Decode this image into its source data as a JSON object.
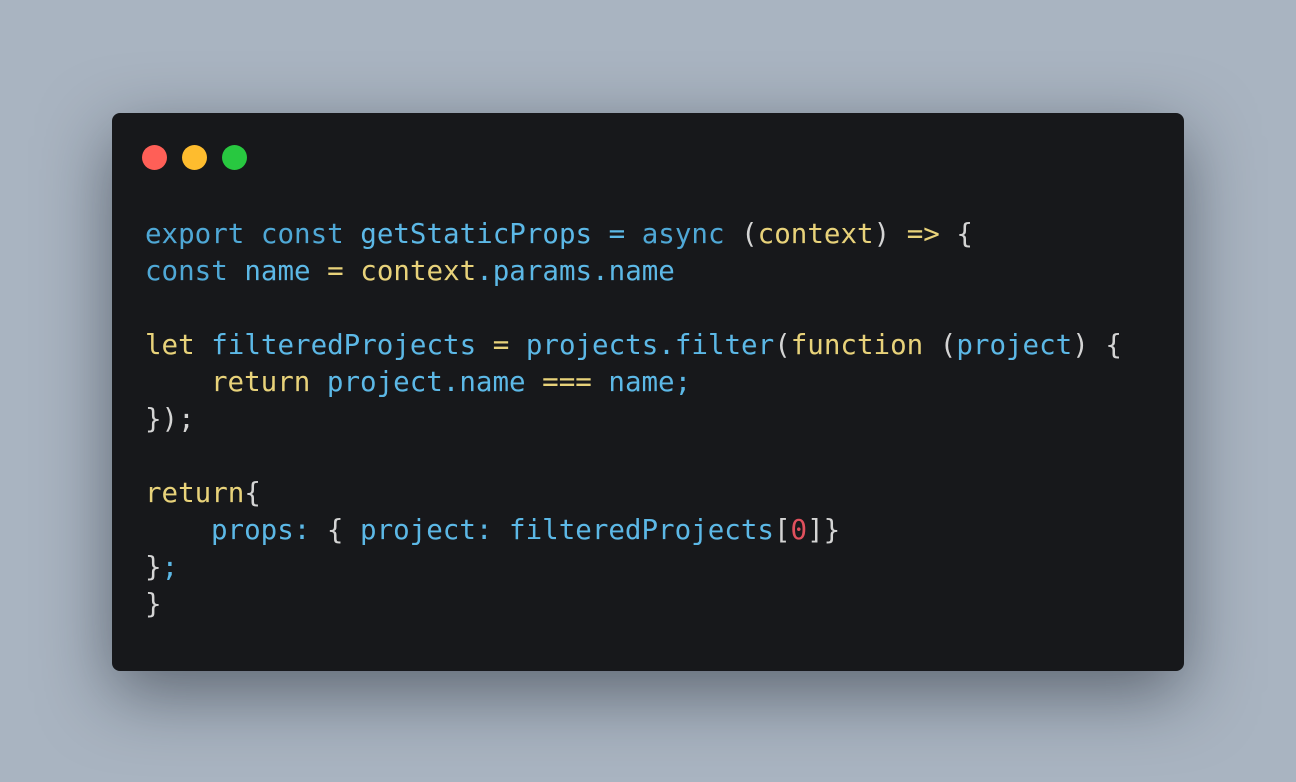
{
  "window": {
    "controls": [
      {
        "name": "close",
        "color": "#ff5f57"
      },
      {
        "name": "minimize",
        "color": "#febc2e"
      },
      {
        "name": "maximize",
        "color": "#28c840"
      }
    ]
  },
  "code": {
    "lines": [
      [
        {
          "text": "export",
          "cls": "kw"
        },
        {
          "text": " ",
          "cls": "pn"
        },
        {
          "text": "const",
          "cls": "kw"
        },
        {
          "text": " ",
          "cls": "pn"
        },
        {
          "text": "getStaticProps",
          "cls": "var"
        },
        {
          "text": " ",
          "cls": "pn"
        },
        {
          "text": "=",
          "cls": "var"
        },
        {
          "text": " ",
          "cls": "pn"
        },
        {
          "text": "async",
          "cls": "kw"
        },
        {
          "text": " ",
          "cls": "pn"
        },
        {
          "text": "(",
          "cls": "pn"
        },
        {
          "text": "context",
          "cls": "fn"
        },
        {
          "text": ")",
          "cls": "pn"
        },
        {
          "text": " ",
          "cls": "pn"
        },
        {
          "text": "=>",
          "cls": "op"
        },
        {
          "text": " {",
          "cls": "pn"
        }
      ],
      [
        {
          "text": "const",
          "cls": "kw"
        },
        {
          "text": " ",
          "cls": "pn"
        },
        {
          "text": "name",
          "cls": "var"
        },
        {
          "text": " ",
          "cls": "pn"
        },
        {
          "text": "=",
          "cls": "op"
        },
        {
          "text": " ",
          "cls": "pn"
        },
        {
          "text": "context",
          "cls": "fn"
        },
        {
          "text": ".params.name",
          "cls": "var"
        }
      ],
      [],
      [
        {
          "text": "let",
          "cls": "fn"
        },
        {
          "text": " ",
          "cls": "pn"
        },
        {
          "text": "filteredProjects",
          "cls": "var"
        },
        {
          "text": " ",
          "cls": "pn"
        },
        {
          "text": "=",
          "cls": "op"
        },
        {
          "text": " ",
          "cls": "pn"
        },
        {
          "text": "projects.filter",
          "cls": "var"
        },
        {
          "text": "(",
          "cls": "pn"
        },
        {
          "text": "function",
          "cls": "fn"
        },
        {
          "text": " (",
          "cls": "pn"
        },
        {
          "text": "project",
          "cls": "var"
        },
        {
          "text": ") {",
          "cls": "pn"
        }
      ],
      [
        {
          "text": "return",
          "cls": "fn"
        },
        {
          "text": " ",
          "cls": "pn"
        },
        {
          "text": "project.name",
          "cls": "var"
        },
        {
          "text": " ",
          "cls": "pn"
        },
        {
          "text": "===",
          "cls": "op"
        },
        {
          "text": " ",
          "cls": "pn"
        },
        {
          "text": "name;",
          "cls": "var"
        }
      ],
      [
        {
          "text": "});",
          "cls": "pn"
        }
      ],
      [],
      [
        {
          "text": "return",
          "cls": "fn"
        },
        {
          "text": "{",
          "cls": "pn"
        }
      ],
      [
        {
          "text": "props:",
          "cls": "var"
        },
        {
          "text": " { ",
          "cls": "pn"
        },
        {
          "text": "project:",
          "cls": "var"
        },
        {
          "text": " ",
          "cls": "pn"
        },
        {
          "text": "filteredProjects",
          "cls": "var"
        },
        {
          "text": "[",
          "cls": "pn"
        },
        {
          "text": "0",
          "cls": "num"
        },
        {
          "text": "]}",
          "cls": "pn"
        }
      ],
      [
        {
          "text": "}",
          "cls": "pn"
        },
        {
          "text": ";",
          "cls": "var"
        }
      ],
      [
        {
          "text": "}",
          "cls": "pn"
        }
      ]
    ],
    "indents": [
      0,
      0,
      0,
      0,
      1,
      0,
      0,
      0,
      1,
      0,
      0
    ]
  }
}
